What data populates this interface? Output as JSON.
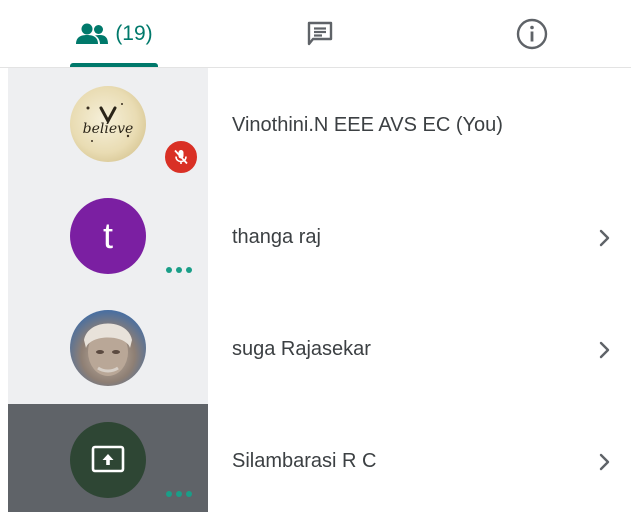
{
  "tabs": {
    "people": {
      "icon": "people-icon",
      "count": "(19)",
      "active": true
    },
    "chat": {
      "icon": "chat-icon"
    },
    "info": {
      "icon": "info-icon"
    }
  },
  "participants": [
    {
      "name": "Vinothini.N EEE AVS EC (You)",
      "avatar": "believe-avatar",
      "avatar_text": "believe",
      "status": "muted",
      "has_chevron": false
    },
    {
      "name": "thanga raj",
      "avatar": "letter-avatar",
      "avatar_text": "t",
      "status": "speaking-dots",
      "has_chevron": true
    },
    {
      "name": "suga Rajasekar",
      "avatar": "photo-avatar",
      "status": "muted",
      "has_chevron": true
    },
    {
      "name": "Silambarasi R C",
      "avatar": "screen-share-avatar",
      "status": "speaking-dots",
      "has_chevron": true,
      "presenting": true
    }
  ],
  "colors": {
    "accent": "#00796b",
    "muted_badge": "#d93025",
    "letter_avatar": "#7b1fa2",
    "dots": "#1a9e88"
  }
}
